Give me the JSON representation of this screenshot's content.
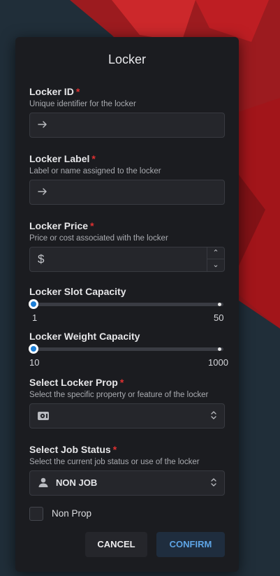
{
  "dialog": {
    "title": "Locker"
  },
  "fields": {
    "locker_id": {
      "label": "Locker ID",
      "required_mark": "*",
      "description": "Unique identifier for the locker",
      "value": ""
    },
    "locker_label": {
      "label": "Locker Label",
      "required_mark": "*",
      "description": "Label or name assigned to the locker",
      "value": ""
    },
    "locker_price": {
      "label": "Locker Price",
      "required_mark": "*",
      "description": "Price or cost associated with the locker",
      "value": "",
      "prefix": "$"
    },
    "slot_capacity": {
      "label": "Locker Slot Capacity",
      "min": "1",
      "max": "50",
      "value": 1
    },
    "weight_capacity": {
      "label": "Locker Weight Capacity",
      "min": "10",
      "max": "1000",
      "value": 10
    },
    "locker_prop": {
      "label": "Select Locker Prop",
      "required_mark": "*",
      "description": "Select the specific property or feature of the locker",
      "value": "",
      "icon": "prop-icon"
    },
    "job_status": {
      "label": "Select Job Status",
      "required_mark": "*",
      "description": "Select the current job status or use of the locker",
      "value": "NON JOB",
      "icon": "user-icon"
    }
  },
  "non_prop": {
    "label": "Non Prop",
    "checked": false
  },
  "buttons": {
    "cancel": "CANCEL",
    "confirm": "CONFIRM"
  },
  "colors": {
    "accent": "#1c7ed6",
    "required": "#e03131",
    "panel": "#1b1c20"
  }
}
